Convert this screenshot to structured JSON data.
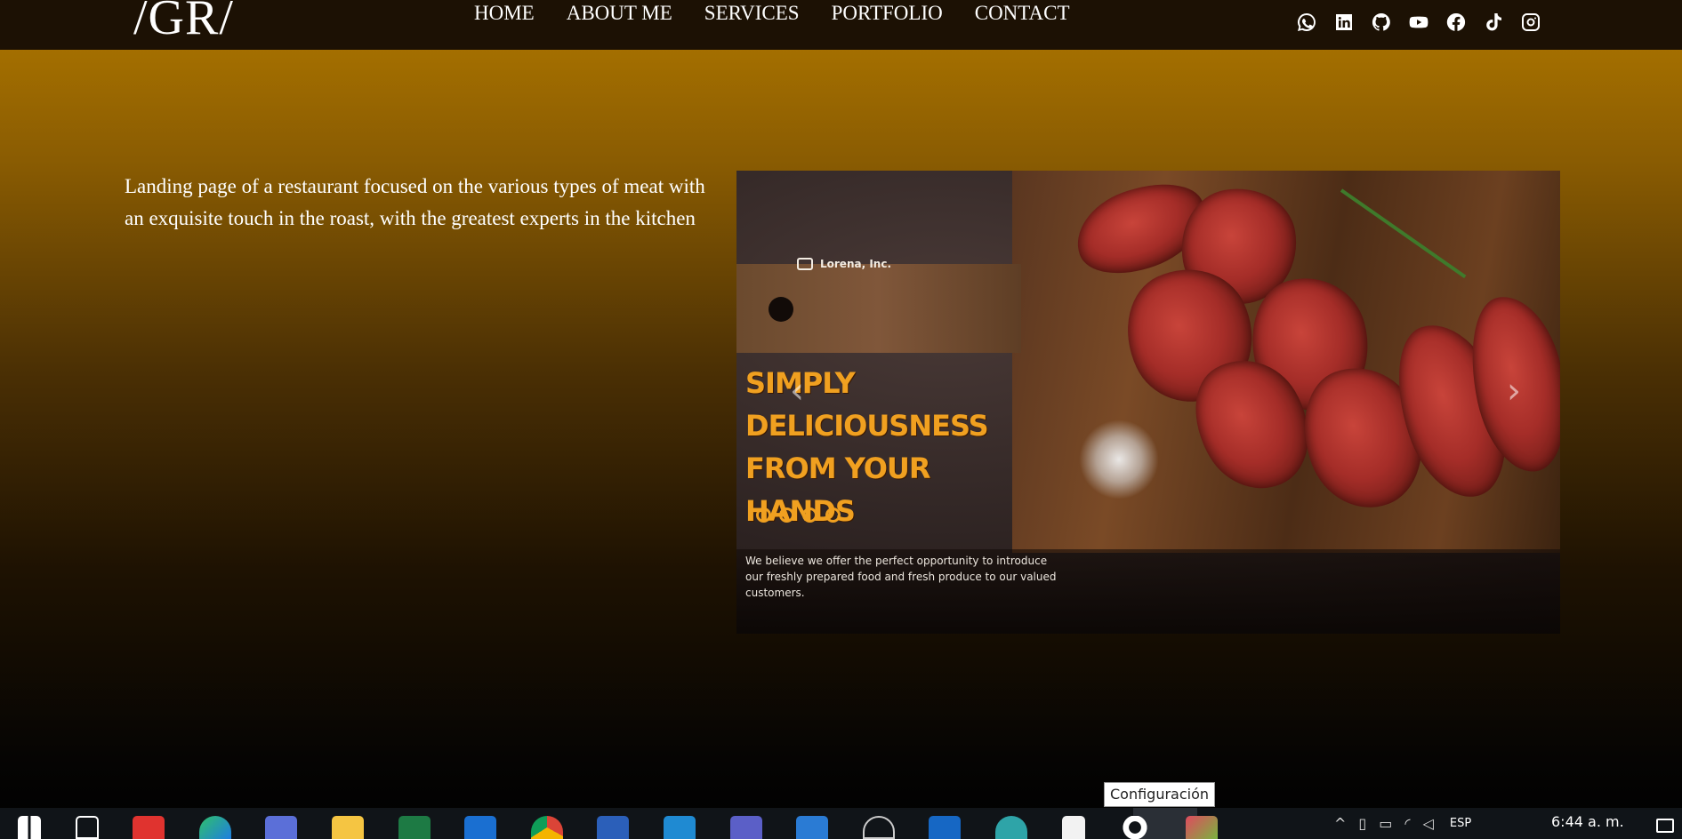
{
  "header": {
    "logo": "/GR/",
    "nav": [
      "HOME",
      "ABOUT ME",
      "SERVICES",
      "PORTFOLIO",
      "CONTACT"
    ],
    "socials": [
      "whatsapp-icon",
      "linkedin-icon",
      "github-icon",
      "youtube-icon",
      "facebook-icon",
      "tiktok-icon",
      "instagram-icon"
    ]
  },
  "main": {
    "description": "Landing page of a restaurant focused on the various types of meat with an exquisite touch in the roast, with the greatest experts in the kitchen"
  },
  "carousel": {
    "brand": "Lorena, Inc.",
    "headline_lines": [
      "SIMPLY",
      "DELICIOUSNESS",
      "FROM YOUR HANDS"
    ],
    "tagline": "We believe we offer the perfect opportunity to introduce our freshly prepared food and fresh produce to our valued customers.",
    "prev_glyph": "‹",
    "next_glyph": "›",
    "slides_count": 4
  },
  "tooltip": {
    "text": "Configuración"
  },
  "taskbar": {
    "apps": [
      "windows-start-icon",
      "task-view-icon",
      "anydesk-icon",
      "edge-icon",
      "bing-icon",
      "file-explorer-icon",
      "excel-icon",
      "sharepoint-icon",
      "chrome-icon",
      "word-icon",
      "vscode-icon",
      "teams-icon",
      "calculator-icon",
      "obs-icon",
      "outlook-icon",
      "app-icon",
      "notepad-icon",
      "settings-icon",
      "git-kraken-icon"
    ],
    "language": "ESP",
    "time": "6:44 a. m."
  },
  "colors": {
    "accent": "#f0a020",
    "header_bg": "#1c1104",
    "gradient_top": "#a46f00"
  }
}
